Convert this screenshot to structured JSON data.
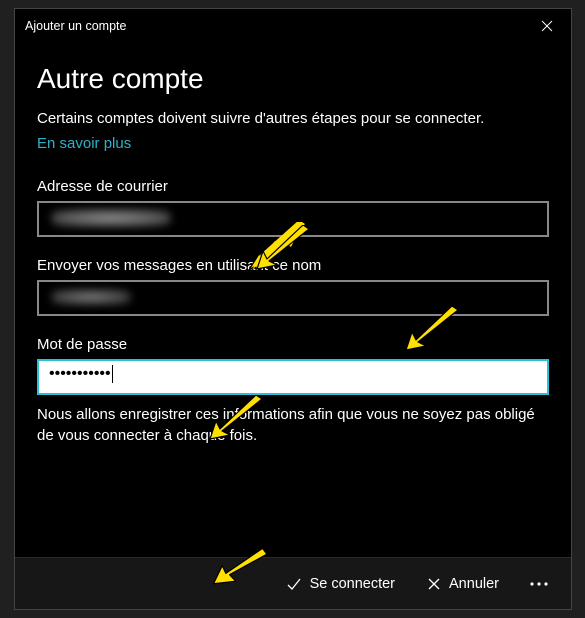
{
  "titlebar": {
    "title": "Ajouter un compte"
  },
  "main": {
    "heading": "Autre compte",
    "description": "Certains comptes doivent suivre d'autres étapes pour se connecter.",
    "learn_more": "En savoir plus"
  },
  "fields": {
    "email": {
      "label": "Adresse de courrier",
      "value": ""
    },
    "display_name": {
      "label": "Envoyer vos messages en utilisant ce nom",
      "value": ""
    },
    "password": {
      "label": "Mot de passe",
      "value": "•••••••••••"
    }
  },
  "info": "Nous allons enregistrer ces informations afin que vous ne soyez pas obligé de vous connecter à chaque fois.",
  "footer": {
    "signin": "Se connecter",
    "cancel": "Annuler"
  }
}
